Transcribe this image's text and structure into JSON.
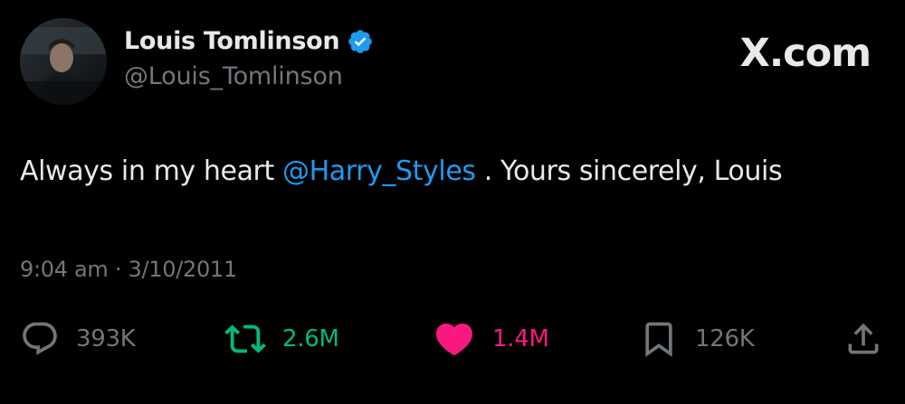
{
  "author": {
    "display_name": "Louis Tomlinson",
    "handle": "@Louis_Tomlinson",
    "verified": true
  },
  "brand": "X.com",
  "tweet": {
    "text_before": "Always in my heart ",
    "mention": "@Harry_Styles",
    "text_after": " . Yours sincerely, Louis",
    "timestamp": "9:04 am · 3/10/2011"
  },
  "actions": {
    "reply": {
      "icon": "reply-icon",
      "count": "393K",
      "color": "#71767b"
    },
    "retweet": {
      "icon": "retweet-icon",
      "count": "2.6M",
      "color": "#00ba7c"
    },
    "like": {
      "icon": "heart-icon",
      "count": "1.4M",
      "color": "#f91880"
    },
    "bookmark": {
      "icon": "bookmark-icon",
      "count": "126K",
      "color": "#71767b"
    },
    "share": {
      "icon": "share-icon"
    }
  },
  "colors": {
    "background": "#000000",
    "text": "#e7e9ea",
    "muted": "#71767b",
    "link": "#1d9bf0",
    "verified": "#1d9bf0"
  }
}
